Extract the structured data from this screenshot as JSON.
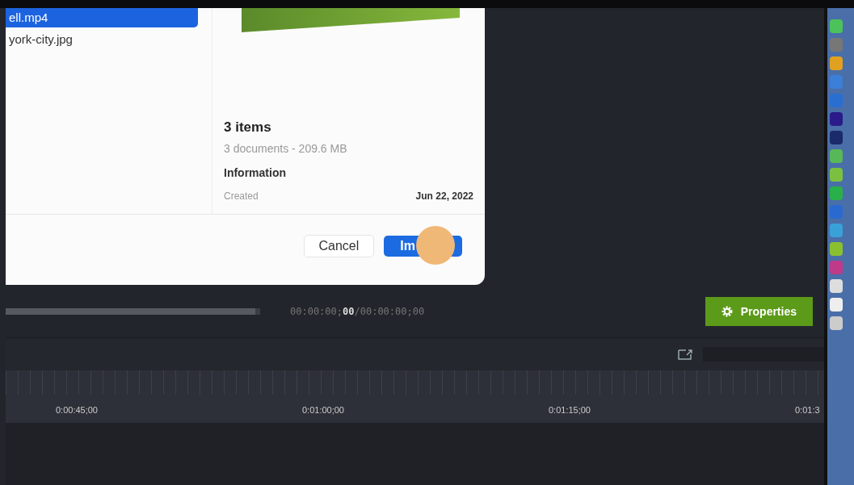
{
  "dialog": {
    "files": [
      {
        "name": "ell.mp4",
        "selected": true
      },
      {
        "name": "york-city.jpg",
        "selected": false
      }
    ],
    "preview": {
      "title": "3 items",
      "subtitle": "3 documents - 209.6 MB",
      "section": "Information",
      "created_label": "Created",
      "created_value": "Jun 22, 2022"
    },
    "buttons": {
      "cancel": "Cancel",
      "import": "Im"
    }
  },
  "player": {
    "level": 0.98,
    "timecode": "00:00:00;**00**/00:00:00;00",
    "properties": "Properties"
  },
  "ruler": {
    "labels": [
      "0:00:45;00",
      "0:01:00;00",
      "0:01:15;00",
      "0:01:3"
    ]
  }
}
